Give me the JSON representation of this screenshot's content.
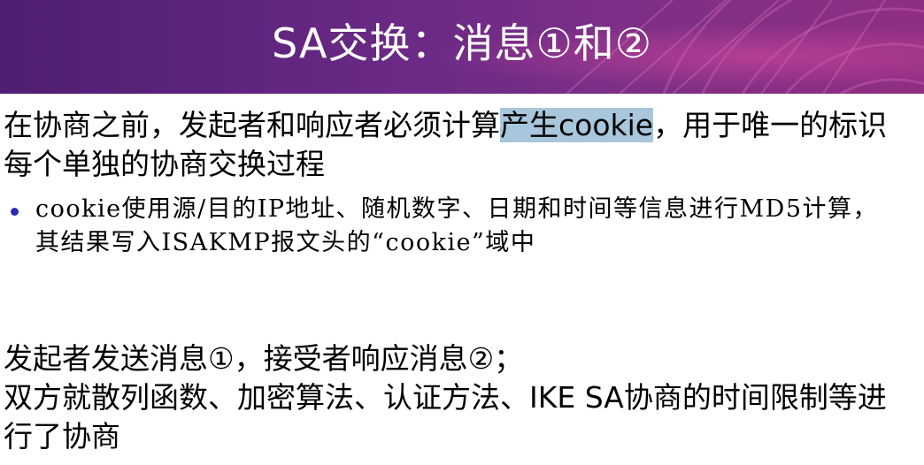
{
  "slide": {
    "title": "SA交换：消息①和②",
    "paragraph1": {
      "before": "在协商之前，发起者和响应者必须计算",
      "highlight": "产生cookie",
      "after": "，用于唯一的标识每个单独的协商交换过程"
    },
    "bullet": "cookie使用源/目的IP地址、随机数字、日期和时间等信息进行MD5计算，其结果写入ISAKMP报文头的“cookie”域中",
    "paragraph2": {
      "line1": "发起者发送消息①，接受者响应消息②；",
      "line2": "双方就散列函数、加密算法、认证方法、IKE SA协商的时间限制等进行了协商"
    }
  },
  "colors": {
    "header_start": "#4f1e73",
    "header_end": "#8f2f82",
    "highlight": "#a8c6dc",
    "bullet": "#2a2ab8"
  }
}
